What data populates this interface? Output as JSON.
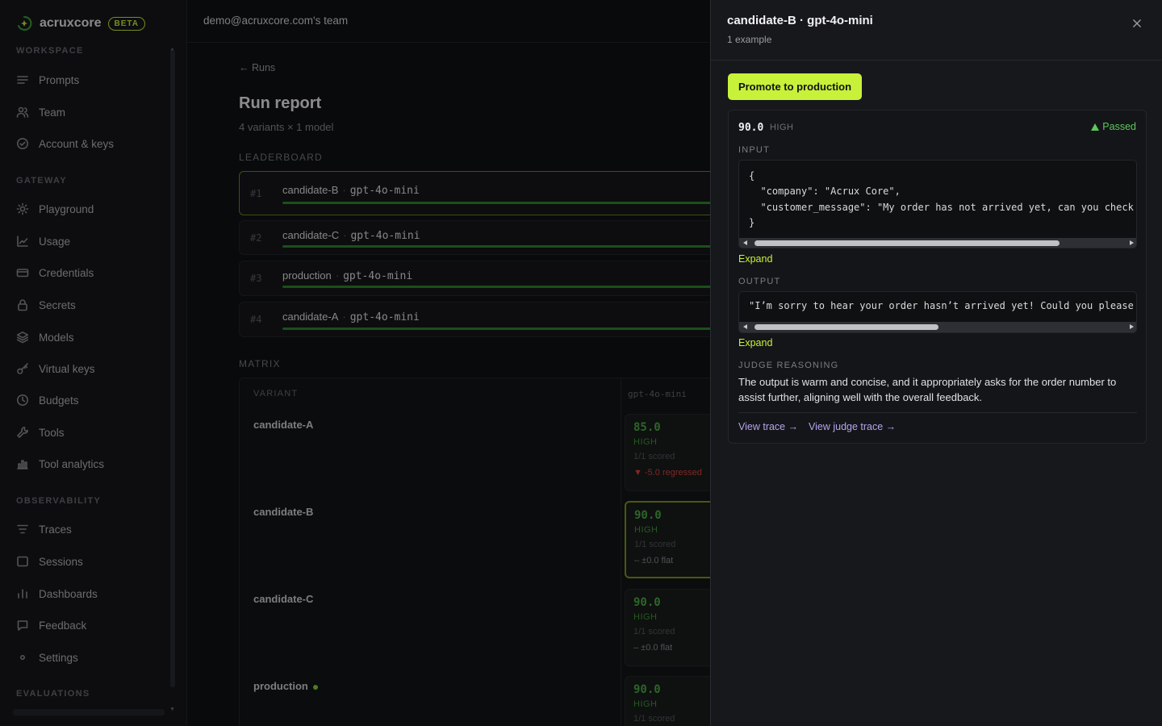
{
  "brand": {
    "name": "acruxcore",
    "badge": "BETA"
  },
  "sidebar": {
    "sections": [
      {
        "title": "WORKSPACE",
        "items": [
          {
            "label": "Prompts",
            "icon": "list-icon"
          },
          {
            "label": "Team",
            "icon": "users-icon"
          },
          {
            "label": "Account & keys",
            "icon": "check-circle-icon"
          }
        ]
      },
      {
        "title": "GATEWAY",
        "items": [
          {
            "label": "Playground",
            "icon": "sun-icon"
          },
          {
            "label": "Usage",
            "icon": "line-chart-icon"
          },
          {
            "label": "Credentials",
            "icon": "card-icon"
          },
          {
            "label": "Secrets",
            "icon": "lock-icon"
          },
          {
            "label": "Models",
            "icon": "layers-icon"
          },
          {
            "label": "Virtual keys",
            "icon": "key-icon"
          },
          {
            "label": "Budgets",
            "icon": "clock-icon"
          },
          {
            "label": "Tools",
            "icon": "wrench-icon"
          },
          {
            "label": "Tool analytics",
            "icon": "bar-chart-icon"
          }
        ]
      },
      {
        "title": "OBSERVABILITY",
        "items": [
          {
            "label": "Traces",
            "icon": "traces-icon"
          },
          {
            "label": "Sessions",
            "icon": "message-square-icon"
          },
          {
            "label": "Dashboards",
            "icon": "bar-chart-icon"
          },
          {
            "label": "Feedback",
            "icon": "message-icon"
          },
          {
            "label": "Settings",
            "icon": "gear-icon"
          }
        ]
      },
      {
        "title": "EVALUATIONS",
        "items": []
      }
    ]
  },
  "topbar": {
    "team": "demo@acruxcore.com's team"
  },
  "main": {
    "back": "Runs",
    "title": "Run report",
    "subtitle": "4 variants × 1 model",
    "leaderboard_label": "LEADERBOARD",
    "leaderboard": [
      {
        "rank": "#1",
        "variant": "candidate-B",
        "model": "gpt-4o-mini",
        "fraction": 1.0
      },
      {
        "rank": "#2",
        "variant": "candidate-C",
        "model": "gpt-4o-mini",
        "fraction": 1.0
      },
      {
        "rank": "#3",
        "variant": "production",
        "model": "gpt-4o-mini",
        "fraction": 1.0
      },
      {
        "rank": "#4",
        "variant": "candidate-A",
        "model": "gpt-4o-mini",
        "fraction": 1.0
      }
    ],
    "matrix_label": "MATRIX",
    "matrix": {
      "variant_header": "VARIANT",
      "model_header": "gpt-4o-mini",
      "rows": [
        {
          "variant": "candidate-A",
          "score": "85.0",
          "level": "HIGH",
          "scored": "1/1 scored",
          "delta": "-5.0 regressed",
          "delta_kind": "regressed",
          "selected": false,
          "live": false
        },
        {
          "variant": "candidate-B",
          "score": "90.0",
          "level": "HIGH",
          "scored": "1/1 scored",
          "delta": "– ±0.0 flat",
          "delta_kind": "flat",
          "selected": true,
          "live": false
        },
        {
          "variant": "candidate-C",
          "score": "90.0",
          "level": "HIGH",
          "scored": "1/1 scored",
          "delta": "– ±0.0 flat",
          "delta_kind": "flat",
          "selected": false,
          "live": false
        },
        {
          "variant": "production",
          "score": "90.0",
          "level": "HIGH",
          "scored": "1/1 scored",
          "delta": "",
          "delta_kind": "",
          "selected": false,
          "live": true
        }
      ]
    }
  },
  "drawer": {
    "title": "candidate-B · gpt-4o-mini",
    "subtitle": "1 example",
    "promote_label": "Promote to production",
    "example": {
      "score": "90.0",
      "level": "HIGH",
      "status": "Passed",
      "input_label": "INPUT",
      "input_lines": [
        "{",
        "  \"company\": \"Acrux Core\",",
        "  \"customer_message\": \"My order has not arrived yet, can you check",
        "}"
      ],
      "input_scroll_fraction": 0.83,
      "output_label": "OUTPUT",
      "output_text": "\"I’m sorry to hear your order hasn’t arrived yet! Could you please",
      "output_scroll_fraction": 0.5,
      "expand_label": "Expand",
      "reasoning_label": "JUDGE REASONING",
      "reasoning": "The output is warm and concise, and it appropriately asks for the order number to assist further, aligning well with the overall feedback.",
      "view_trace": "View trace →",
      "view_judge_trace": "View judge trace →"
    }
  }
}
